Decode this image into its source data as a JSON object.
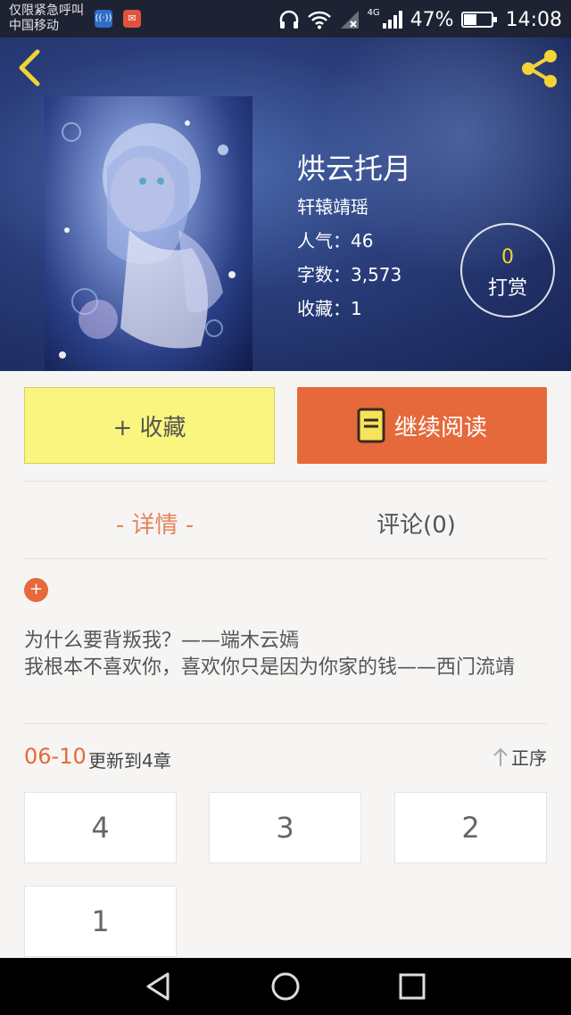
{
  "status_bar": {
    "carrier_line1": "仅限紧急呼叫",
    "carrier_line2": "中国移动",
    "network": "4G",
    "battery": "47%",
    "battery_level": 0.47,
    "time": "14:08"
  },
  "book": {
    "title": "烘云托月",
    "author": "轩辕靖瑶",
    "popularity": "人气：46",
    "word_count": "字数：3,573",
    "favorites": "收藏：1"
  },
  "reward": {
    "count": "0",
    "label": "打赏"
  },
  "actions": {
    "favorite_label": "+ 收藏",
    "read_label": "继续阅读"
  },
  "tabs": [
    {
      "label": "- 详情 -",
      "active": true
    },
    {
      "label": "评论(0)",
      "active": false
    }
  ],
  "intro": {
    "expand_icon": "+",
    "line1": "为什么要背叛我？——端木云嫣",
    "line2": "我根本不喜欢你，喜欢你只是因为你家的钱——西门流靖"
  },
  "update": {
    "date": "06-10",
    "text": "更新到4章",
    "sort_label": "正序"
  },
  "chapters": [
    "4",
    "3",
    "2",
    "1"
  ],
  "colors": {
    "accent": "#e5693b",
    "fav_button": "#faf57e",
    "reward_count": "#f4d23c"
  }
}
